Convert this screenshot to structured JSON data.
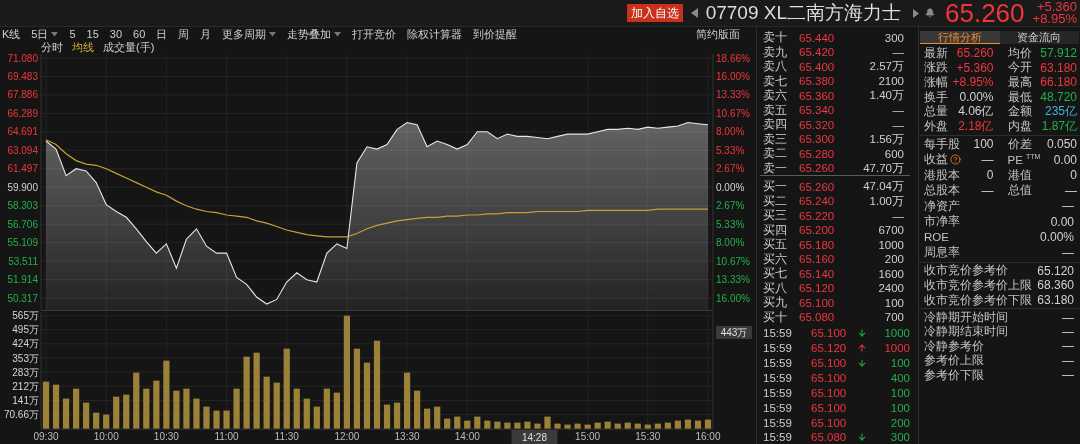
{
  "header": {
    "add_button": "加入自选",
    "title": "07709 XL二南方海力士",
    "price": "65.260",
    "change": "+5.360",
    "change_pct": "+8.95%",
    "color": "#f0353c"
  },
  "toolbar": {
    "items": [
      {
        "label": "K线",
        "dropdown": false
      },
      {
        "label": "5日",
        "dropdown": true
      },
      {
        "label": "5",
        "dropdown": false
      },
      {
        "label": "15",
        "dropdown": false
      },
      {
        "label": "30",
        "dropdown": false
      },
      {
        "label": "60",
        "dropdown": false
      },
      {
        "label": "日",
        "dropdown": false
      },
      {
        "label": "周",
        "dropdown": false
      },
      {
        "label": "月",
        "dropdown": false
      },
      {
        "label": "更多周期",
        "dropdown": true
      },
      {
        "label": "走势叠加",
        "dropdown": true
      },
      {
        "label": "打开竞价",
        "dropdown": false
      },
      {
        "label": "除权计算器",
        "dropdown": false
      },
      {
        "label": "到价提醒",
        "dropdown": false
      }
    ],
    "layout_button": "简约版面"
  },
  "legend": [
    {
      "label": "分时"
    },
    {
      "label": "均线",
      "color": "#d6aa3a"
    },
    {
      "label": "成交量(手)"
    }
  ],
  "price_chart": {
    "chart_data": {
      "type": "line",
      "grid": true,
      "categories": [
        null,
        null,
        null,
        null,
        null,
        null,
        null,
        null,
        null,
        null,
        null,
        null,
        null,
        null,
        null,
        null,
        null,
        null,
        null,
        null,
        null,
        null,
        null,
        null,
        null,
        null,
        null,
        null,
        null,
        null,
        null,
        null,
        null,
        null,
        null,
        null,
        null,
        null,
        null,
        null,
        null,
        null,
        null,
        null,
        null,
        null,
        null,
        null,
        null,
        null,
        null,
        null,
        null,
        null,
        null,
        null,
        null,
        null,
        null,
        null,
        null,
        null,
        null,
        null,
        null,
        null,
        null
      ],
      "series": [
        {
          "type": "area",
          "color": "#e6e6e6",
          "values": [
            63.9,
            63.2,
            60.9,
            61.5,
            61.3,
            60.3,
            58.4,
            57.8,
            57.3,
            56.3,
            55.2,
            54.2,
            55.0,
            52.9,
            55.4,
            56.3,
            54.8,
            54.2,
            54.2,
            52.1,
            51.5,
            50.4,
            49.8,
            50.2,
            51.7,
            52.5,
            51.9,
            51.7,
            54.2,
            55.0,
            54.6,
            62.0,
            63.4,
            63.2,
            63.6,
            64.9,
            65.5,
            65.3,
            63.4,
            63.9,
            63.6,
            63.2,
            63.6,
            64.7,
            64.7,
            64.1,
            64.5,
            64.3,
            64.3,
            64.2,
            64.1,
            64.3,
            64.5,
            64.5,
            64.5,
            64.7,
            64.9,
            64.9,
            65.0,
            64.9,
            65.1,
            65.0,
            65.1,
            65.2,
            65.5,
            65.4,
            65.3
          ]
        },
        {
          "type": "line",
          "color": "#c9a033",
          "values": [
            64.0,
            63.6,
            62.8,
            62.2,
            61.9,
            61.8,
            61.5,
            61.1,
            60.7,
            60.3,
            59.9,
            59.5,
            59.2,
            58.7,
            58.3,
            58.0,
            57.8,
            57.7,
            57.5,
            57.4,
            57.3,
            57.0,
            56.8,
            56.5,
            56.2,
            56.0,
            55.8,
            55.7,
            55.6,
            55.6,
            55.6,
            55.9,
            56.3,
            56.6,
            56.8,
            57.0,
            57.1,
            57.2,
            57.3,
            57.3,
            57.4,
            57.4,
            57.5,
            57.5,
            57.6,
            57.6,
            57.7,
            57.7,
            57.7,
            57.8,
            57.8,
            57.8,
            57.8,
            57.8,
            57.9,
            57.9,
            57.9,
            57.9,
            57.9,
            57.9,
            57.9,
            58.0,
            58.0,
            58.0,
            58.0,
            58.0,
            58.0
          ]
        }
      ],
      "ylim": [
        49.279,
        71.426
      ],
      "yticks": [
        {
          "value": 71.08,
          "label": "71.080"
        },
        {
          "value": 69.483,
          "label": "69.483"
        },
        {
          "value": 67.886,
          "label": "67.886"
        },
        {
          "value": 66.289,
          "label": "66.289"
        },
        {
          "value": 64.691,
          "label": "64.691"
        },
        {
          "value": 63.094,
          "label": "63.094"
        },
        {
          "value": 61.497,
          "label": "61.497"
        },
        {
          "value": 59.9,
          "label": "59.900"
        },
        {
          "value": 58.303,
          "label": "58.303"
        },
        {
          "value": 56.706,
          "label": "56.706"
        },
        {
          "value": 55.109,
          "label": "55.109"
        },
        {
          "value": 53.511,
          "label": "53.511"
        },
        {
          "value": 51.914,
          "label": "51.914"
        },
        {
          "value": 50.317,
          "label": "50.317"
        }
      ]
    },
    "percent_ticks": [
      "18.66%",
      "16.00%",
      "13.33%",
      "10.67%",
      "8.00%",
      "5.33%",
      "2.67%",
      "0.00%",
      "2.67%",
      "5.33%",
      "8.00%",
      "10.67%",
      "13.33%",
      "16.00%"
    ]
  },
  "volume_chart": {
    "chart_data": {
      "type": "bar",
      "grid": true,
      "categories": [
        "09:30",
        null,
        null,
        null,
        null,
        null,
        "10:00",
        null,
        null,
        null,
        null,
        null,
        "10:30",
        null,
        null,
        null,
        null,
        null,
        "11:00",
        null,
        null,
        null,
        null,
        null,
        "11:30",
        null,
        null,
        null,
        null,
        null,
        "12:00",
        null,
        null,
        null,
        null,
        null,
        "13:30",
        null,
        null,
        null,
        null,
        null,
        "14:00",
        null,
        null,
        null,
        null,
        null,
        null,
        null,
        null,
        null,
        null,
        null,
        "15:00",
        null,
        null,
        null,
        null,
        null,
        "15:30",
        null,
        null,
        null,
        null,
        null,
        "16:00"
      ],
      "values": [
        235,
        220,
        150,
        200,
        130,
        80,
        70,
        160,
        170,
        280,
        200,
        240,
        340,
        190,
        200,
        150,
        110,
        90,
        90,
        200,
        360,
        380,
        260,
        230,
        400,
        200,
        150,
        110,
        200,
        180,
        565,
        400,
        330,
        440,
        120,
        130,
        280,
        190,
        100,
        110,
        50,
        60,
        40,
        60,
        40,
        35,
        30,
        30,
        35,
        25,
        60,
        25,
        20,
        25,
        20,
        30,
        35,
        25,
        30,
        25,
        20,
        25,
        30,
        40,
        45,
        40,
        45
      ],
      "ylim": [
        0,
        593.5
      ],
      "yticks": [
        {
          "value": 565,
          "label": "565万"
        },
        {
          "value": 495,
          "label": "495万"
        },
        {
          "value": 424,
          "label": "424万"
        },
        {
          "value": 353,
          "label": "353万"
        },
        {
          "value": 283,
          "label": "283万"
        },
        {
          "value": 212,
          "label": "212万"
        },
        {
          "value": 141,
          "label": "141万"
        },
        {
          "value": 70.66,
          "label": "70.66万"
        }
      ]
    },
    "cursor_time": "14:28",
    "cursor_volume": "443万"
  },
  "order_book": {
    "asks": [
      {
        "label": "卖十",
        "price": "65.440",
        "volume": "300"
      },
      {
        "label": "卖九",
        "price": "65.420",
        "volume": "—"
      },
      {
        "label": "卖八",
        "price": "65.400",
        "volume": "2.57万"
      },
      {
        "label": "卖七",
        "price": "65.380",
        "volume": "2100"
      },
      {
        "label": "卖六",
        "price": "65.360",
        "volume": "1.40万"
      },
      {
        "label": "卖五",
        "price": "65.340",
        "volume": "—"
      },
      {
        "label": "卖四",
        "price": "65.320",
        "volume": "—"
      },
      {
        "label": "卖三",
        "price": "65.300",
        "volume": "1.56万"
      },
      {
        "label": "卖二",
        "price": "65.280",
        "volume": "600"
      },
      {
        "label": "卖一",
        "price": "65.260",
        "volume": "47.70万"
      }
    ],
    "bids": [
      {
        "label": "买一",
        "price": "65.260",
        "volume": "47.04万"
      },
      {
        "label": "买二",
        "price": "65.240",
        "volume": "1.00万"
      },
      {
        "label": "买三",
        "price": "65.220",
        "volume": "—"
      },
      {
        "label": "买四",
        "price": "65.200",
        "volume": "6700"
      },
      {
        "label": "买五",
        "price": "65.180",
        "volume": "1000"
      },
      {
        "label": "买六",
        "price": "65.160",
        "volume": "200"
      },
      {
        "label": "买七",
        "price": "65.140",
        "volume": "1600"
      },
      {
        "label": "买八",
        "price": "65.120",
        "volume": "2400"
      },
      {
        "label": "买九",
        "price": "65.100",
        "volume": "100"
      },
      {
        "label": "买十",
        "price": "65.080",
        "volume": "700"
      }
    ]
  },
  "trades": [
    {
      "time": "15:59",
      "price": "65.100",
      "kind": "down",
      "volume": "1000",
      "color": "#22b14c"
    },
    {
      "time": "15:59",
      "price": "65.120",
      "kind": "up",
      "volume": "1000",
      "color": "#f0353c"
    },
    {
      "time": "15:59",
      "price": "65.100",
      "kind": "down",
      "volume": "100",
      "color": "#22b14c"
    },
    {
      "time": "15:59",
      "price": "65.100",
      "kind": "plain",
      "volume": "400",
      "color": "#22b14c"
    },
    {
      "time": "15:59",
      "price": "65.100",
      "kind": "plain",
      "volume": "100",
      "color": "#22b14c"
    },
    {
      "time": "15:59",
      "price": "65.100",
      "kind": "plain",
      "volume": "100",
      "color": "#22b14c"
    },
    {
      "time": "15:59",
      "price": "65.100",
      "kind": "plain",
      "volume": "200",
      "color": "#22b14c"
    },
    {
      "time": "15:59",
      "price": "65.080",
      "kind": "down",
      "volume": "300",
      "color": "#22b14c"
    }
  ],
  "quote_panel": {
    "tabs": [
      {
        "label": "行情分析",
        "selected": true
      },
      {
        "label": "资金流向",
        "selected": false
      }
    ],
    "sections": [
      {
        "rows": [
          [
            {
              "label": "最新",
              "value": "65.260",
              "color": "#f0353c"
            },
            {
              "label": "均价",
              "value": "57.912",
              "color": "#22b14c"
            }
          ],
          [
            {
              "label": "涨跌",
              "value": "+5.360",
              "color": "#f0353c"
            },
            {
              "label": "今开",
              "value": "63.180",
              "color": "#f0353c"
            }
          ],
          [
            {
              "label": "涨幅",
              "value": "+8.95%",
              "color": "#f0353c"
            },
            {
              "label": "最高",
              "value": "66.180",
              "color": "#f0353c"
            }
          ],
          [
            {
              "label": "换手",
              "value": "0.00%"
            },
            {
              "label": "最低",
              "value": "48.720",
              "color": "#22b14c"
            }
          ],
          [
            {
              "label": "总量",
              "value": "4.06亿"
            },
            {
              "label": "金额",
              "value": "235亿",
              "color": "#3cb6cf"
            }
          ],
          [
            {
              "label": "外盘",
              "value": "2.18亿",
              "color": "#f0353c"
            },
            {
              "label": "内盘",
              "value": "1.87亿",
              "color": "#22b14c"
            }
          ]
        ]
      },
      {
        "rows": [
          [
            {
              "label": "每手股",
              "value": "100"
            },
            {
              "label": "价差",
              "value": "0.050"
            }
          ],
          [
            {
              "label": "收益",
              "value": "—",
              "help": true
            },
            {
              "label": "PE $^{TTM}$",
              "value": "0.00"
            }
          ],
          [
            {
              "label": "港股本",
              "value": "0"
            },
            {
              "label": "港值",
              "value": "0"
            }
          ],
          [
            {
              "label": "总股本",
              "value": "—"
            },
            {
              "label": "总值",
              "value": "—"
            }
          ],
          [
            {
              "label": "净资产",
              "value": "—"
            }
          ],
          [
            {
              "label": "市净率",
              "value": "0.00"
            }
          ],
          [
            {
              "label": "ROE",
              "value": "0.00%"
            }
          ],
          [
            {
              "label": "周息率",
              "value": "—"
            }
          ]
        ]
      },
      {
        "rows": [
          [
            {
              "label": "收市竞价参考价",
              "value": "65.120"
            }
          ],
          [
            {
              "label": "收市竞价参考价上限",
              "value": "68.360"
            }
          ],
          [
            {
              "label": "收市竞价参考价下限",
              "value": "63.180"
            }
          ]
        ]
      },
      {
        "rows": [
          [
            {
              "label": "冷静期开始时间",
              "value": "—"
            }
          ],
          [
            {
              "label": "冷静期结束时间",
              "value": "—"
            }
          ],
          [
            {
              "label": "冷静参考价",
              "value": "—"
            }
          ],
          [
            {
              "label": "参考价上限",
              "value": "—"
            }
          ],
          [
            {
              "label": "参考价下限",
              "value": "—"
            }
          ]
        ]
      }
    ]
  }
}
